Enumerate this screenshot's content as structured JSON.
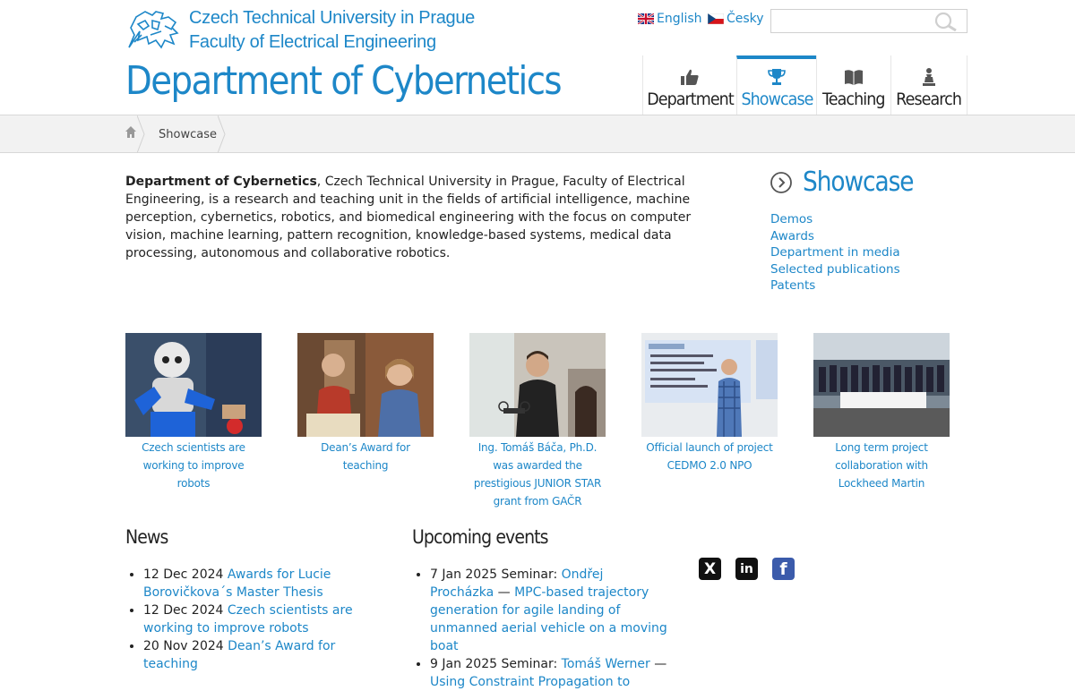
{
  "header": {
    "university": "Czech Technical University in Prague",
    "faculty": "Faculty of Electrical Engineering",
    "department": "Department of Cybernetics",
    "lang_en": "English",
    "lang_cz": "Česky",
    "search_placeholder": ""
  },
  "tabs": [
    {
      "label": "Department",
      "icon": "thumbs-up-icon"
    },
    {
      "label": "Showcase",
      "icon": "trophy-icon"
    },
    {
      "label": "Teaching",
      "icon": "book-icon"
    },
    {
      "label": "Research",
      "icon": "chess-pawn-icon"
    }
  ],
  "breadcrumb": {
    "current": "Showcase"
  },
  "intro": {
    "bold": "Department of Cybernetics",
    "text": ", Czech Technical University in Prague, Faculty of Electrical Engineering, is a research and teaching unit in the fields of artificial intelligence, machine perception, cybernetics, robotics, and biomedical engineering with the focus on computer vision, machine learning, pattern recognition, knowledge-based systems, medical data processing, autonomous and collaborative robotics."
  },
  "showcase": {
    "title": "Showcase",
    "links": [
      "Demos",
      "Awards",
      "Department in media",
      "Selected publications",
      "Patents"
    ]
  },
  "cards": [
    {
      "caption": "Czech scientists are working to improve robots"
    },
    {
      "caption": "Dean’s Award for teaching"
    },
    {
      "caption": "Ing. Tomáš Báča, Ph.D. was awarded the prestigious JUNIOR STAR grant from GAČR"
    },
    {
      "caption": "Official launch of project CEDMO 2.0 NPO"
    },
    {
      "caption": "Long term project collaboration with Lockheed Martin"
    }
  ],
  "news": {
    "title": "News",
    "items": [
      {
        "date": "12 Dec 2024",
        "link": "Awards for Lucie Borovičkova´s Master Thesis"
      },
      {
        "date": "12 Dec 2024",
        "link": "Czech scientists are working to improve robots"
      },
      {
        "date": "20 Nov 2024",
        "link": "Dean’s Award for teaching"
      }
    ]
  },
  "events": {
    "title": "Upcoming events",
    "items": [
      {
        "date": "7 Jan 2025",
        "kind": "Seminar:",
        "speaker": "Ondřej Procházka",
        "dash": "—",
        "talk": "MPC-based trajectory generation for agile landing of unmanned aerial vehicle on a moving boat"
      },
      {
        "date": "9 Jan 2025",
        "kind": "Seminar:",
        "speaker": "Tomáš Werner",
        "dash": "—",
        "talk": "Using Constraint Propagation to"
      }
    ]
  },
  "social": [
    {
      "name": "x-icon",
      "glyph": "X"
    },
    {
      "name": "linkedin-icon",
      "glyph": "in"
    },
    {
      "name": "facebook-icon",
      "glyph": "f"
    }
  ],
  "colors": {
    "accent": "#1d87c8",
    "text": "#222222",
    "crumb_bg": "#f2f2f2"
  }
}
